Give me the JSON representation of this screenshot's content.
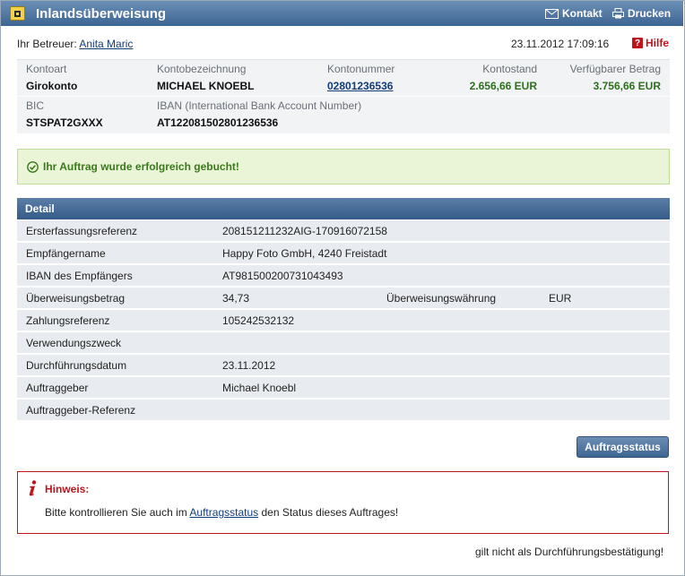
{
  "titlebar": {
    "title": "Inlandsüberweisung",
    "contact_label": "Kontakt",
    "print_label": "Drucken"
  },
  "advisor": {
    "label": "Ihr Betreuer:",
    "name": "Anita Maric"
  },
  "datetime": "23.11.2012 17:09:16",
  "help_label": "Hilfe",
  "account": {
    "labels": {
      "kontoart": "Kontoart",
      "kontobezeichnung": "Kontobezeichnung",
      "kontonummer": "Kontonummer",
      "kontostand": "Kontostand",
      "verfuegbar": "Verfügbarer Betrag",
      "bic": "BIC",
      "iban": "IBAN (International Bank Account Number)"
    },
    "values": {
      "kontoart": "Girokonto",
      "kontobezeichnung": "MICHAEL KNOEBL",
      "kontonummer": "02801236536",
      "kontostand": "2.656,66 EUR",
      "verfuegbar": "3.756,66 EUR",
      "bic": "STSPAT2GXXX",
      "iban": "AT122081502801236536"
    }
  },
  "success_message": "Ihr Auftrag wurde erfolgreich gebucht!",
  "detail": {
    "header": "Detail",
    "rows": [
      {
        "label": "Ersterfassungsreferenz",
        "value": "208151211232AIG-170916072158"
      },
      {
        "label": "Empfängername",
        "value": "Happy Foto GmbH, 4240 Freistadt"
      },
      {
        "label": "IBAN des Empfängers",
        "value": "AT981500200731043493"
      },
      {
        "label": "Überweisungsbetrag",
        "value": "34,73",
        "label2": "Überweisungswährung",
        "value2": "EUR"
      },
      {
        "label": "Zahlungsreferenz",
        "value": "105242532132"
      },
      {
        "label": "Verwendungszweck",
        "value": ""
      },
      {
        "label": "Durchführungsdatum",
        "value": "23.11.2012"
      },
      {
        "label": "Auftraggeber",
        "value": "Michael Knoebl"
      },
      {
        "label": "Auftraggeber-Referenz",
        "value": ""
      }
    ]
  },
  "status_button": "Auftragsstatus",
  "hint": {
    "title": "Hinweis:",
    "text_before": "Bitte kontrollieren Sie auch im ",
    "link": "Auftragsstatus",
    "text_after": " den Status dieses Auftrages!"
  },
  "footer_note": "gilt nicht als Durchführungsbestätigung!",
  "colors": {
    "titlebar": "#3d6592",
    "success_bg": "#e9f5d6",
    "success_text": "#3b7a1c",
    "amount_green": "#2e6f1e",
    "hint_red": "#c0141d"
  }
}
